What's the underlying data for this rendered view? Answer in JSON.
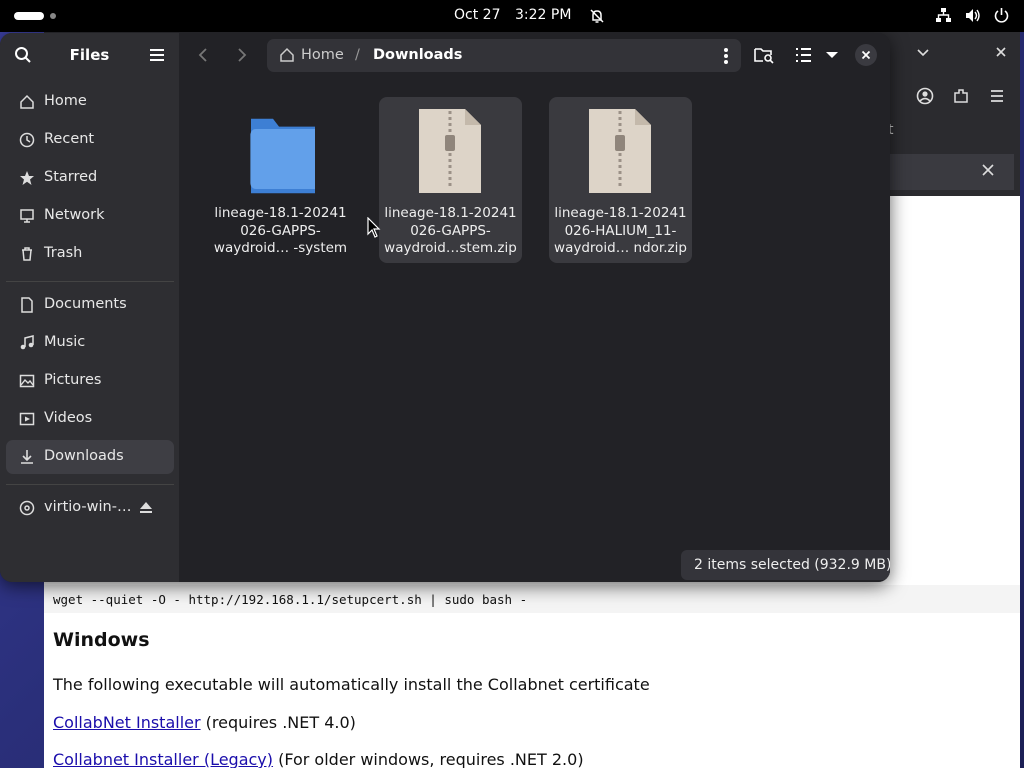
{
  "topbar": {
    "date": "Oct 27",
    "time": "3:22 PM"
  },
  "files": {
    "title": "Files",
    "sidebar": {
      "places": [
        {
          "label": "Home",
          "icon": "home-icon"
        },
        {
          "label": "Recent",
          "icon": "clock-icon"
        },
        {
          "label": "Starred",
          "icon": "star-icon"
        },
        {
          "label": "Network",
          "icon": "network-icon"
        },
        {
          "label": "Trash",
          "icon": "trash-icon"
        }
      ],
      "bookmarks": [
        {
          "label": "Documents",
          "icon": "document-icon"
        },
        {
          "label": "Music",
          "icon": "music-icon"
        },
        {
          "label": "Pictures",
          "icon": "picture-icon"
        },
        {
          "label": "Videos",
          "icon": "video-icon"
        },
        {
          "label": "Downloads",
          "icon": "download-icon",
          "active": true
        }
      ],
      "devices": [
        {
          "label": "virtio-win-…",
          "icon": "disc-icon"
        }
      ]
    },
    "path": {
      "home": "Home",
      "separator": "/",
      "current": "Downloads"
    },
    "items": [
      {
        "name_lines": [
          "lineage-18.1-20241",
          "026-GAPPS-",
          "waydroid… -system"
        ],
        "type": "folder",
        "selected": false
      },
      {
        "name_lines": [
          "lineage-18.1-20241",
          "026-GAPPS-",
          "waydroid…stem.zip"
        ],
        "type": "zip",
        "selected": true
      },
      {
        "name_lines": [
          "lineage-18.1-20241",
          "026-HALIUM_11-",
          "waydroid… ndor.zip"
        ],
        "type": "zip",
        "selected": true
      }
    ],
    "status": "2 items selected  (932.9 MB)"
  },
  "browser": {
    "url_snippet": "t",
    "code": "wget --quiet -O - http://192.168.1.1/setupcert.sh | sudo bash -",
    "heading": "Windows",
    "paragraph": "The following executable will automatically install the Collabnet certificate",
    "links": [
      {
        "link": "CollabNet Installer",
        "note": " (requires .NET 4.0)"
      },
      {
        "link": "Collabnet Installer (Legacy)",
        "note": " (For older windows, requires .NET 2.0)"
      }
    ]
  },
  "colors": {
    "folder": "#62a0ea",
    "zip_bg": "#ddd4c8",
    "accent_link": "#1a0dab"
  }
}
